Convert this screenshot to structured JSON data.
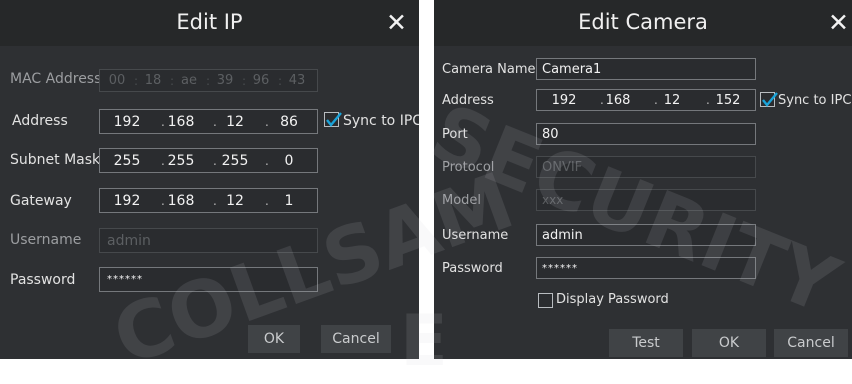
{
  "edit_ip": {
    "title": "Edit IP",
    "close_label": "✕",
    "mac_label": "MAC Address",
    "mac": [
      "00",
      "18",
      "ae",
      "39",
      "96",
      "43"
    ],
    "address_label": "Address",
    "address": [
      "192",
      "168",
      "12",
      "86"
    ],
    "sync_label": "Sync to IPC",
    "sync_checked": true,
    "subnet_label": "Subnet Mask",
    "subnet": [
      "255",
      "255",
      "255",
      "0"
    ],
    "gateway_label": "Gateway",
    "gateway": [
      "192",
      "168",
      "12",
      "1"
    ],
    "username_label": "Username",
    "username": "admin",
    "password_label": "Password",
    "password": "******",
    "ok_label": "OK",
    "cancel_label": "Cancel"
  },
  "edit_camera": {
    "title": "Edit Camera",
    "close_label": "✕",
    "camera_name_label": "Camera Name",
    "camera_name": "Camera1",
    "address_label": "Address",
    "address": [
      "192",
      "168",
      "12",
      "152"
    ],
    "sync_label": "Sync to IPC",
    "sync_checked": true,
    "port_label": "Port",
    "port": "80",
    "protocol_label": "Protocol",
    "protocol": "ONVIF",
    "model_label": "Model",
    "model": "xxx",
    "username_label": "Username",
    "username": "admin",
    "password_label": "Password",
    "password": "******",
    "display_password_label": "Display Password",
    "display_password_checked": false,
    "test_label": "Test",
    "ok_label": "OK",
    "cancel_label": "Cancel"
  },
  "watermark": [
    "COLLSAM",
    "SECURITY",
    "E"
  ],
  "colors": {
    "dialog_bg": "#2e3033",
    "checkbox_check": "#1aa3d9",
    "button_bg": "#404346"
  }
}
